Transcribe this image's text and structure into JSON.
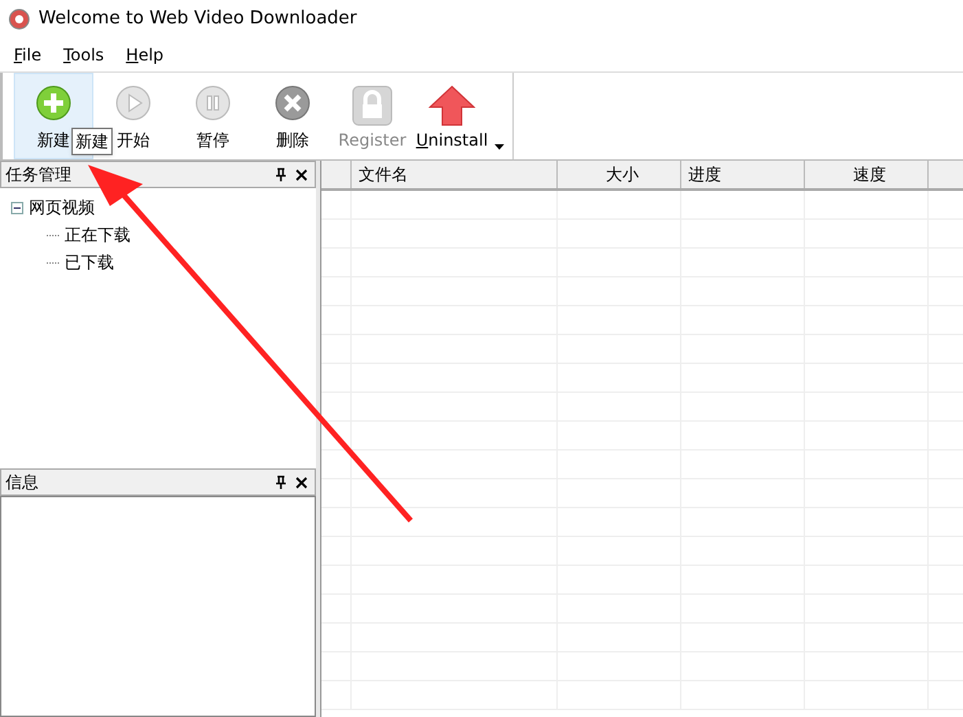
{
  "window": {
    "title": "Welcome to Web Video Downloader"
  },
  "menu": [
    {
      "label": "File",
      "mnemonic": true
    },
    {
      "label": "Tools",
      "mnemonic": true
    },
    {
      "label": "Help",
      "mnemonic": true
    }
  ],
  "toolbar": [
    {
      "kind": "add",
      "label": "新建",
      "disabled": false,
      "hovered": true
    },
    {
      "kind": "play",
      "label": "开始",
      "disabled": true,
      "hovered": false
    },
    {
      "kind": "pause",
      "label": "暂停",
      "disabled": true,
      "hovered": false
    },
    {
      "kind": "delete",
      "label": "删除",
      "disabled": false,
      "hovered": false
    },
    {
      "kind": "lock",
      "label": "Register",
      "disabled": true,
      "hovered": false
    },
    {
      "kind": "uninstall",
      "label": "Uninstall",
      "disabled": false,
      "hovered": false
    }
  ],
  "tooltip": "新建",
  "task_panel": {
    "title": "任务管理",
    "tree": [
      {
        "label": "网页视频",
        "expanded": true,
        "children": [
          {
            "label": "正在下载"
          },
          {
            "label": "已下载"
          }
        ]
      }
    ]
  },
  "info_panel": {
    "title": "信息"
  },
  "table": {
    "columns": [
      "",
      "文件名",
      "大小",
      "进度",
      "速度",
      ""
    ]
  }
}
